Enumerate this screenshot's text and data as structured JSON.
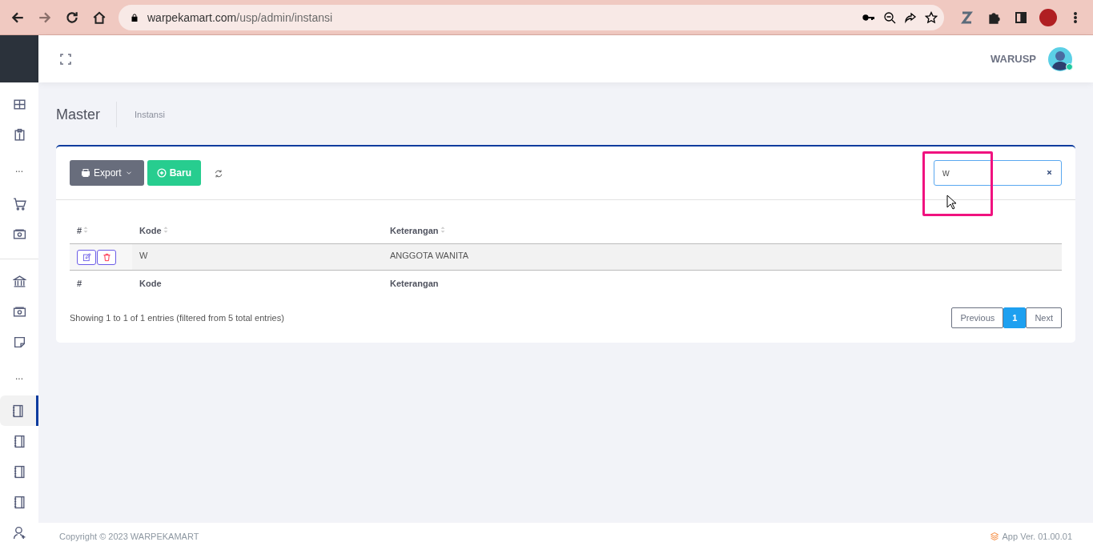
{
  "browser": {
    "url_host": "warpekamart.com",
    "url_path": "/usp/admin/instansi"
  },
  "sidebar": {
    "items": [
      {
        "kind": "icon",
        "selected": false
      },
      {
        "kind": "icon",
        "selected": false
      },
      {
        "kind": "dots",
        "text": "..."
      },
      {
        "kind": "icon",
        "selected": false
      },
      {
        "kind": "icon",
        "selected": false
      },
      {
        "kind": "divider"
      },
      {
        "kind": "icon",
        "selected": false
      },
      {
        "kind": "icon",
        "selected": false
      },
      {
        "kind": "icon",
        "selected": false
      },
      {
        "kind": "dots",
        "text": "..."
      },
      {
        "kind": "icon",
        "selected": true
      },
      {
        "kind": "icon",
        "selected": false
      },
      {
        "kind": "icon",
        "selected": false
      },
      {
        "kind": "icon",
        "selected": false
      },
      {
        "kind": "icon",
        "selected": false
      }
    ]
  },
  "header": {
    "user": "WARUSP",
    "online": true
  },
  "breadcrumb": {
    "title": "Master",
    "page": "Instansi"
  },
  "toolbar": {
    "export": "Export",
    "new": "Baru"
  },
  "search": {
    "value": "w"
  },
  "table": {
    "columns": [
      "#",
      "Kode",
      "Keterangan"
    ],
    "rows": [
      {
        "cells": [
          "",
          "W",
          "ANGGOTA WANITA"
        ]
      }
    ],
    "footer_columns": [
      "#",
      "Kode",
      "Keterangan"
    ]
  },
  "info": "Showing 1 to 1 of 1 entries (filtered from 5 total entries)",
  "pagination": {
    "previous": "Previous",
    "pages": [
      {
        "label": "1",
        "selected": true
      }
    ],
    "next": "Next"
  },
  "footer": {
    "copyright": "Copyright © 2023 WARPEKAMART",
    "version": "App Ver. 01.00.01"
  }
}
